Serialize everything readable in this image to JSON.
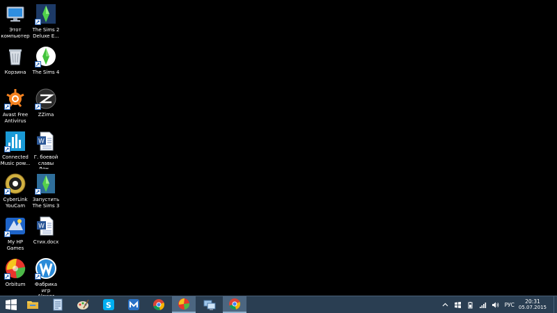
{
  "desktop": {
    "icons": [
      {
        "label": "Этот\nкомпьютер",
        "icon": "computer-icon"
      },
      {
        "label": "The Sims 2\nDeluxe E...",
        "icon": "sims2-icon"
      },
      {
        "label": "Корзина",
        "icon": "recycle-bin-icon"
      },
      {
        "label": "The Sims 4",
        "icon": "sims4-icon"
      },
      {
        "label": "Avast Free\nAntivirus",
        "icon": "avast-icon"
      },
      {
        "label": "ZZima",
        "icon": "zzima-icon"
      },
      {
        "label": "Connected\nMusic pow...",
        "icon": "connected-music-icon"
      },
      {
        "label": "Г. боевой\nславы Дон...",
        "icon": "word-document-icon"
      },
      {
        "label": "CyberLink\nYouCam",
        "icon": "youcam-icon"
      },
      {
        "label": "Запустить\nThe Sims 3",
        "icon": "sims3-icon"
      },
      {
        "label": "My HP\nGames",
        "icon": "hp-games-icon"
      },
      {
        "label": "Стих.docx",
        "icon": "word-document-icon"
      },
      {
        "label": "Orbitum",
        "icon": "orbitum-icon"
      },
      {
        "label": "Фабрика игр\nAlawar",
        "icon": "alawar-icon"
      }
    ]
  },
  "taskbar": {
    "pinned": [
      {
        "name": "start-button",
        "icon": "windows-logo-icon"
      },
      {
        "name": "file-explorer-button",
        "icon": "folder-icon"
      },
      {
        "name": "notepad-button",
        "icon": "document-icon"
      },
      {
        "name": "paint-button",
        "icon": "paint-icon"
      },
      {
        "name": "skype-button",
        "icon": "skype-icon"
      },
      {
        "name": "maxthon-button",
        "icon": "maxthon-icon"
      },
      {
        "name": "chrome-button",
        "icon": "chrome-icon"
      },
      {
        "name": "orbitum-button",
        "icon": "orbitum-icon"
      },
      {
        "name": "remote-desktop-button",
        "icon": "remote-desktop-icon"
      },
      {
        "name": "chrome-active-button",
        "icon": "chrome-icon"
      }
    ],
    "tray": {
      "language": "РУС",
      "time": "20:31",
      "date": "05.07.2015"
    }
  },
  "colors": {
    "desktop_background": "#000000",
    "taskbar": "#2a3e52",
    "taskbar_active": "#4c6680"
  }
}
